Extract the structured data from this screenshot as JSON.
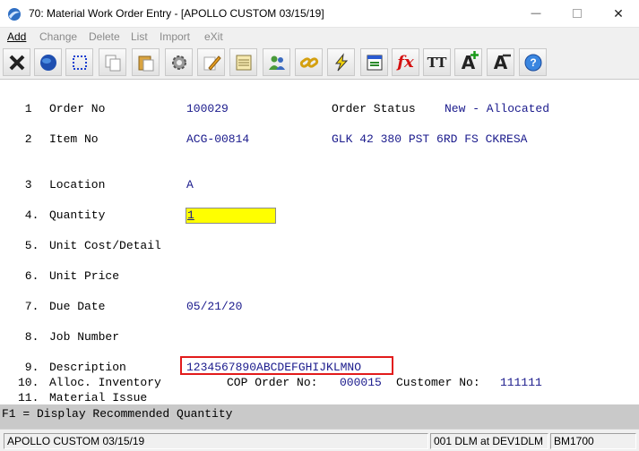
{
  "window": {
    "title": "70: Material Work Order Entry - [APOLLO CUSTOM 03/15/19]",
    "minimize": "—",
    "close": "✕"
  },
  "menu": [
    {
      "label": "Add",
      "enabled": true
    },
    {
      "label": "Change",
      "enabled": false
    },
    {
      "label": "Delete",
      "enabled": false
    },
    {
      "label": "List",
      "enabled": false
    },
    {
      "label": "Import",
      "enabled": false
    },
    {
      "label": "eXit",
      "enabled": false
    }
  ],
  "toolbar": {
    "buttons": [
      "close-icon",
      "globe-icon",
      "select-icon",
      "copy-icon",
      "paste-icon",
      "settings-icon",
      "edit-icon",
      "notes-icon",
      "users-icon",
      "link-icon",
      "lightning-icon",
      "screen-icon",
      "function-icon",
      "font-icon",
      "font-increase-icon",
      "font-decrease-icon",
      "help-icon"
    ],
    "fx_label": "fx",
    "font_label": "TT",
    "font_inc_label": "A",
    "font_dec_label": "A"
  },
  "form": {
    "fields": [
      {
        "num": " 1",
        "label": "Order No",
        "value": "100029"
      },
      {
        "num": " 2",
        "label": "Item No",
        "value": "ACG-00814"
      },
      {
        "num": " 3",
        "label": "Location",
        "value": "A"
      },
      {
        "num": " 4.",
        "label": "Quantity",
        "value": "1"
      },
      {
        "num": " 5.",
        "label": "Unit Cost/Detail",
        "value": ""
      },
      {
        "num": " 6.",
        "label": "Unit Price",
        "value": ""
      },
      {
        "num": " 7.",
        "label": "Due Date",
        "value": "05/21/20"
      },
      {
        "num": " 8.",
        "label": "Job Number",
        "value": ""
      },
      {
        "num": " 9.",
        "label": "Description",
        "value": "1234567890ABCDEFGHIJKLMNO"
      },
      {
        "num": "10.",
        "label": "Alloc. Inventory",
        "value": ""
      },
      {
        "num": "11.",
        "label": "Material Issue",
        "value": ""
      }
    ],
    "order_status_label": "Order Status",
    "order_status_value": "New - Allocated",
    "item_description": "GLK 42 380 PST 6RD FS CKRESA",
    "cop_order_label": "COP Order No:",
    "cop_order_value": "000015",
    "customer_label": "Customer No:",
    "customer_value": "111111"
  },
  "help_line": "F1 = Display Recommended Quantity",
  "status": {
    "company": "APOLLO CUSTOM 03/15/19",
    "session": "001 DLM at DEV1DLM",
    "code": "BM1700"
  },
  "colors": {
    "value_text": "#1a1a8c",
    "quantity_field": "#ffff00",
    "highlight_border": "#e21b1b"
  }
}
